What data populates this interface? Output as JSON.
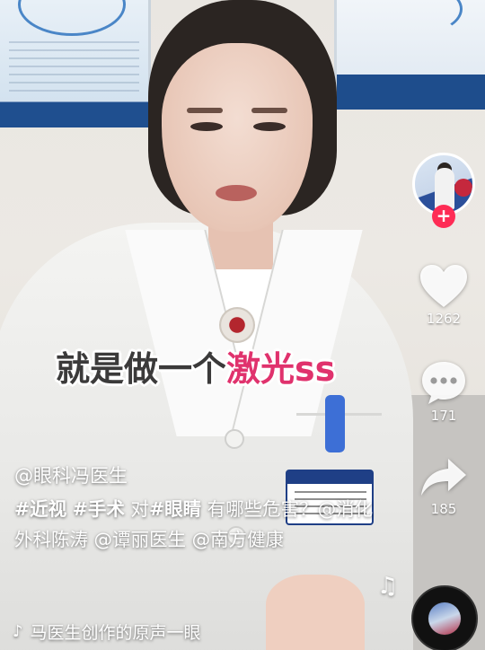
{
  "video": {
    "caption_part1": "就是做一个",
    "caption_part2": "激光ss"
  },
  "rail": {
    "follow_label": "+",
    "like_count": "1262",
    "comment_count": "171",
    "share_count": "185"
  },
  "post": {
    "author": "@眼科冯医生",
    "desc_tag1": "#近视",
    "desc_tag2": "#手术",
    "desc_text1": "对",
    "desc_tag3": "#眼睛",
    "desc_text2": "有哪些危害？",
    "desc_mention1": "@消化外科陈涛",
    "desc_mention2": "@谭丽医生",
    "desc_mention3": "@南方健康"
  },
  "music": {
    "note_icon": "♪",
    "title": "马医生创作的原声一眼"
  },
  "colors": {
    "accent": "#fe2c55",
    "caption_highlight": "#e0326d",
    "text": "#ffffff"
  }
}
